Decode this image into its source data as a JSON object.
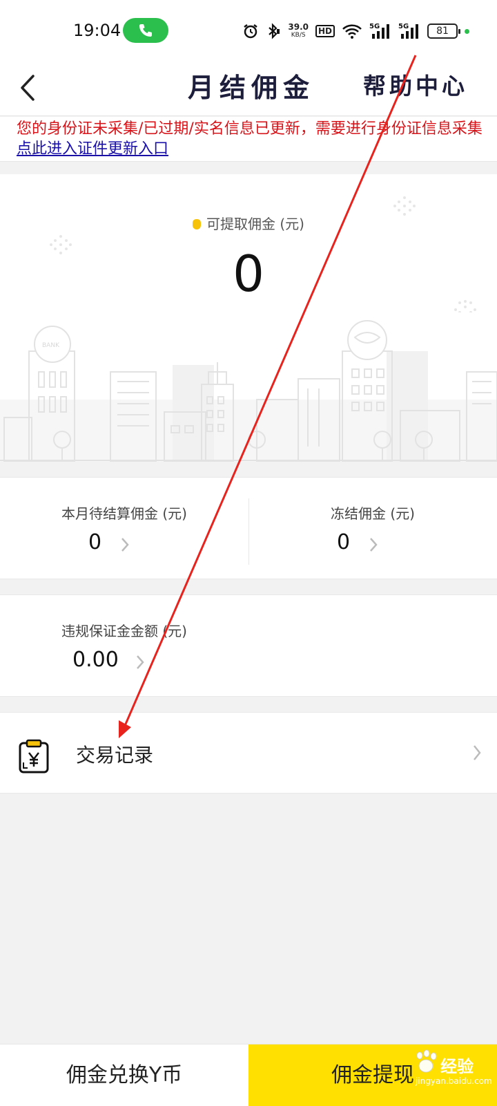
{
  "status_bar": {
    "time": "19:04",
    "net_speed": "39.0",
    "net_unit": "KB/S",
    "hd_badge": "HD",
    "sim1": "5G",
    "sim2": "5G",
    "battery": "81"
  },
  "nav": {
    "title": "月结佣金",
    "help": "帮助中心"
  },
  "notice": {
    "text": "您的身份证未采集/已过期/实名信息已更新，需要进行身份证信息采集 ",
    "link": "点此进入证件更新入口"
  },
  "hero": {
    "label": "可提取佣金 (元)",
    "value": "0",
    "illustration_sign_bank": "BANK"
  },
  "stats": [
    {
      "label": "本月待结算佣金 (元)",
      "value": "0"
    },
    {
      "label": "冻结佣金 (元)",
      "value": "0"
    }
  ],
  "deposit": {
    "label": "违规保证金金额 (元)",
    "value": "0.00"
  },
  "record": {
    "label": "交易记录",
    "icon": "yen-clipboard-icon"
  },
  "bottom": {
    "exchange": "佣金兑换Y币",
    "withdraw": "佣金提现"
  },
  "watermark": {
    "brand": "经验",
    "site": "jingyan.baidu.com"
  },
  "colors": {
    "accent_yellow": "#ffe000",
    "notice_red": "#d7141a",
    "link_blue": "#1a10a8",
    "call_green": "#2bbf4e",
    "annotation_arrow": "#e8231e"
  }
}
